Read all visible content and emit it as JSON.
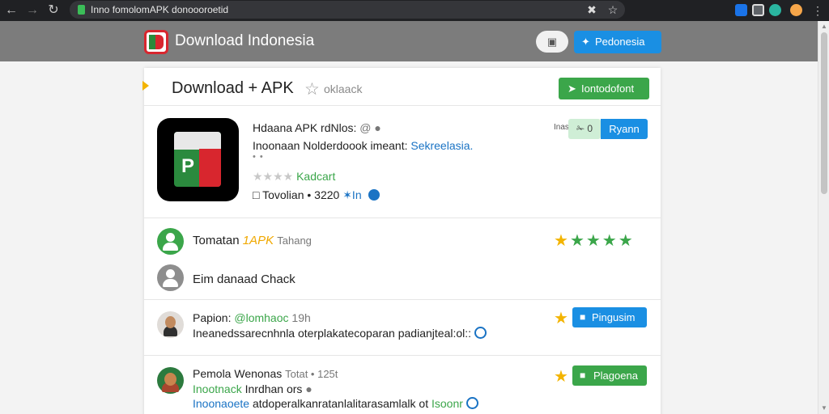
{
  "browser": {
    "url": "Inno fomolomAPK donoooroetid",
    "back_icon": "arrow-left-icon",
    "forward_icon": "arrow-right-icon",
    "reload_icon": "reload-icon"
  },
  "site": {
    "title": "Download Indonesia",
    "lang_button": "Pedonesia"
  },
  "card": {
    "title": "Download + APK",
    "subtitle": "oklaack",
    "download_button": "Iontodofont"
  },
  "app": {
    "name": "Hdaana APK rdNlos:",
    "name_meta": "@",
    "desc": "Inoonaan Nolderdoook  imeant:",
    "desc_link": "Sekreelasia.",
    "dots": "• •",
    "rating_stars": "★★★★",
    "rating_label": "Kadcart",
    "stats_text": "Tovolian • 3220",
    "stats_link": "✶In",
    "small_label": "Inas",
    "toggle_label": "✁ 0",
    "event_button": "Ryann"
  },
  "comments": [
    {
      "name": "Tomatan",
      "tag": "1APK",
      "extra": "Tahang",
      "stars": "★★★★★",
      "text": "Eim danaad Chack"
    },
    {
      "name": "Papion:",
      "handle": "@lomhaoc",
      "time": "19h",
      "text": "Ineanedssarecnhnla oterplakatecoparan padianjteal:ol::",
      "button": "Pingusim"
    },
    {
      "name": "Pemola Wenonas",
      "time": "Totat • 125t",
      "sub": "Inootnack",
      "sub2": "Inrdhan ors",
      "text_link": "Inoonaoete",
      "text": "atdoperalkanratanlalitarasamlalk ot",
      "text_end": "Isoonr",
      "button": "Plagoena"
    }
  ],
  "colors": {
    "accent_blue": "#1a8fe3",
    "accent_green": "#3ba64a",
    "star_orange": "#f3b400",
    "header_gray": "#7c7c7c"
  }
}
